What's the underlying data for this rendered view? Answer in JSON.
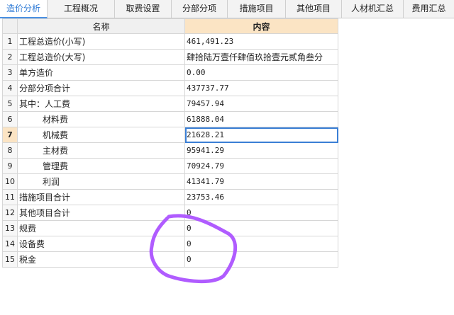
{
  "tabs": [
    {
      "label": "造价分析",
      "active": true
    },
    {
      "label": "工程概况"
    },
    {
      "label": "取费设置"
    },
    {
      "label": "分部分项"
    },
    {
      "label": "措施项目"
    },
    {
      "label": "其他项目"
    },
    {
      "label": "人材机汇总"
    },
    {
      "label": "费用汇总"
    }
  ],
  "table": {
    "headers": {
      "name": "名称",
      "content": "内容"
    },
    "rows": [
      {
        "no": "1",
        "name": "工程总造价(小写)",
        "value": "461,491.23"
      },
      {
        "no": "2",
        "name": "工程总造价(大写)",
        "value": "肆拾陆万壹仟肆佰玖拾壹元贰角叁分"
      },
      {
        "no": "3",
        "name": "单方造价",
        "value": "0.00"
      },
      {
        "no": "4",
        "name": "分部分项合计",
        "value": "437737.77"
      },
      {
        "no": "5",
        "name": "其中：人工费",
        "value": "79457.94"
      },
      {
        "no": "6",
        "name": "材料费",
        "value": "61888.04"
      },
      {
        "no": "7",
        "name": "机械费",
        "value": "21628.21"
      },
      {
        "no": "8",
        "name": "主材费",
        "value": "95941.29"
      },
      {
        "no": "9",
        "name": "管理费",
        "value": "70924.79"
      },
      {
        "no": "10",
        "name": "利润",
        "value": "41341.79"
      },
      {
        "no": "11",
        "name": "措施项目合计",
        "value": "23753.46"
      },
      {
        "no": "12",
        "name": "其他项目合计",
        "value": "0"
      },
      {
        "no": "13",
        "name": "规费",
        "value": "0"
      },
      {
        "no": "14",
        "name": "设备费",
        "value": "0"
      },
      {
        "no": "15",
        "name": "税金",
        "value": "0"
      }
    ]
  },
  "colors": {
    "active_tab": "#2f7bd6",
    "header_highlight": "#fbe4c4",
    "annotation": "#b05cff"
  }
}
